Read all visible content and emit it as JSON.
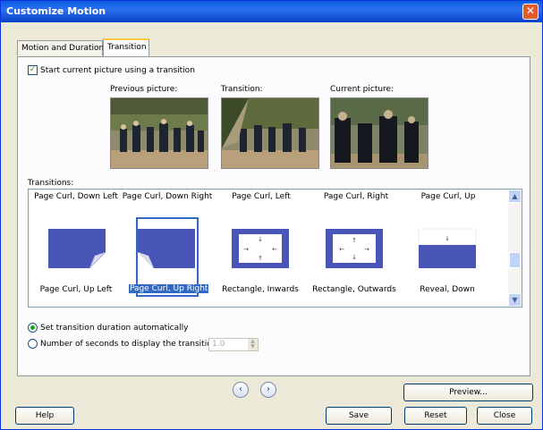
{
  "window": {
    "title": "Customize Motion",
    "close_symbol": "✕"
  },
  "tabs": [
    {
      "label": "Motion and Duration"
    },
    {
      "label": "Transition"
    }
  ],
  "transition_panel": {
    "start_checkbox_label": "Start current picture using a transition",
    "start_checked": true,
    "previous_label": "Previous picture:",
    "transition_label": "Transition:",
    "current_label": "Current picture:",
    "transitions_label": "Transitions:"
  },
  "gallery": {
    "top_row": [
      "Page Curl, Down Left",
      "Page Curl, Down Right",
      "Page Curl, Left",
      "Page Curl, Right",
      "Page Curl, Up"
    ],
    "items": [
      {
        "label": "Page Curl, Up Left",
        "icon": "page-curl-up-left-icon"
      },
      {
        "label": "Page Curl, Up Right",
        "icon": "page-curl-up-right-icon",
        "selected": true
      },
      {
        "label": "Rectangle, Inwards",
        "icon": "rectangle-inwards-icon"
      },
      {
        "label": "Rectangle, Outwards",
        "icon": "rectangle-outwards-icon"
      },
      {
        "label": "Reveal, Down",
        "icon": "reveal-down-icon"
      }
    ]
  },
  "duration": {
    "auto_label": "Set transition duration automatically",
    "auto_selected": true,
    "seconds_label": "Number of seconds to display the transition",
    "seconds_value": "1.0"
  },
  "buttons": {
    "preview": "Preview...",
    "help": "Help",
    "save": "Save",
    "reset": "Reset",
    "close": "Close"
  },
  "colors": {
    "title_bar": "#0a5ce0",
    "tile_blue": "#4a55b8",
    "selection": "#316ac5"
  }
}
